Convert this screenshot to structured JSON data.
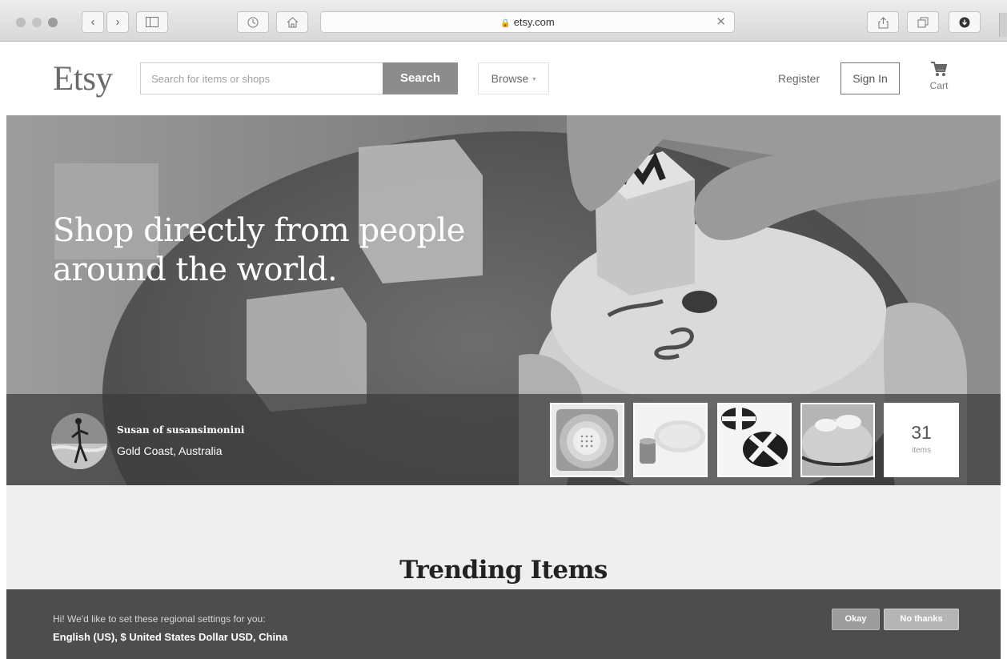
{
  "browser": {
    "url": "etsy.com",
    "lock_glyph": "🔒",
    "clear_glyph": "✕",
    "back_glyph": "‹",
    "forward_glyph": "›"
  },
  "header": {
    "logo": "Etsy",
    "search_placeholder": "Search for items or shops",
    "search_button": "Search",
    "browse_label": "Browse",
    "browse_caret": "▾",
    "register_label": "Register",
    "signin_label": "Sign In",
    "cart_label": "Cart"
  },
  "hero": {
    "headline": "Shop directly from people around the world.",
    "seller": {
      "name": "Susan of susansimonini",
      "location": "Gold Coast, Australia"
    },
    "thumbnails": [
      "colander-bowl-icon",
      "plate-and-cup-icon",
      "striped-bowls-icon",
      "cloud-plate-icon"
    ],
    "item_count": "31",
    "item_count_label": "items"
  },
  "trending": {
    "title": "Trending Items"
  },
  "region_banner": {
    "message": "Hi! We'd like to set these regional settings for you:",
    "settings": "English (US), $ United States Dollar USD, China",
    "okay_button": "Okay",
    "no_thanks_button": "No thanks"
  }
}
